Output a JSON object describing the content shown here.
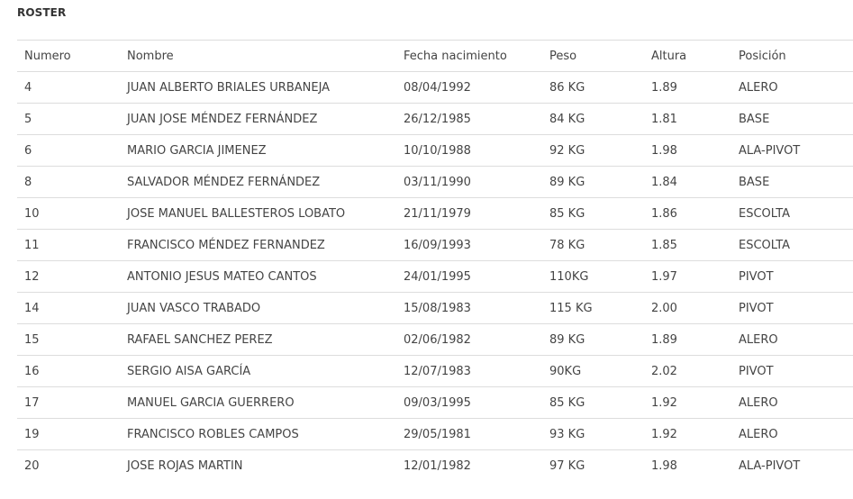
{
  "section_title": "ROSTER",
  "columns": [
    "Numero",
    "Nombre",
    "Fecha nacimiento",
    "Peso",
    "Altura",
    "Posición"
  ],
  "rows": [
    [
      "4",
      "JUAN ALBERTO BRIALES URBANEJA",
      "08/04/1992",
      "86 KG",
      "1.89",
      "ALERO"
    ],
    [
      "5",
      "JUAN JOSE MÉNDEZ FERNÁNDEZ",
      "26/12/1985",
      "84 KG",
      "1.81",
      "BASE"
    ],
    [
      "6",
      "MARIO GARCIA JIMENEZ",
      "10/10/1988",
      "92 KG",
      "1.98",
      "ALA-PIVOT"
    ],
    [
      "8",
      "SALVADOR MÉNDEZ FERNÁNDEZ",
      "03/11/1990",
      "89 KG",
      "1.84",
      "BASE"
    ],
    [
      "10",
      "JOSE MANUEL BALLESTEROS LOBATO",
      "21/11/1979",
      "85 KG",
      "1.86",
      "ESCOLTA"
    ],
    [
      "11",
      "FRANCISCO MÉNDEZ FERNANDEZ",
      "16/09/1993",
      "78 KG",
      "1.85",
      "ESCOLTA"
    ],
    [
      "12",
      "ANTONIO JESUS MATEO CANTOS",
      "24/01/1995",
      "110KG",
      "1.97",
      "PIVOT"
    ],
    [
      "14",
      "JUAN VASCO TRABADO",
      "15/08/1983",
      "115 KG",
      "2.00",
      "PIVOT"
    ],
    [
      "15",
      "RAFAEL SANCHEZ PEREZ",
      "02/06/1982",
      "89 KG",
      "1.89",
      "ALERO"
    ],
    [
      "16",
      "SERGIO AISA GARCÍA",
      "12/07/1983",
      "90KG",
      "2.02",
      "PIVOT"
    ],
    [
      "17",
      "MANUEL GARCIA GUERRERO",
      "09/03/1995",
      "85 KG",
      "1.92",
      "ALERO"
    ],
    [
      "19",
      "FRANCISCO ROBLES CAMPOS",
      "29/05/1981",
      "93 KG",
      "1.92",
      "ALERO"
    ],
    [
      "20",
      "JOSE ROJAS MARTIN",
      "12/01/1982",
      "97 KG",
      "1.98",
      "ALA-PIVOT"
    ]
  ]
}
